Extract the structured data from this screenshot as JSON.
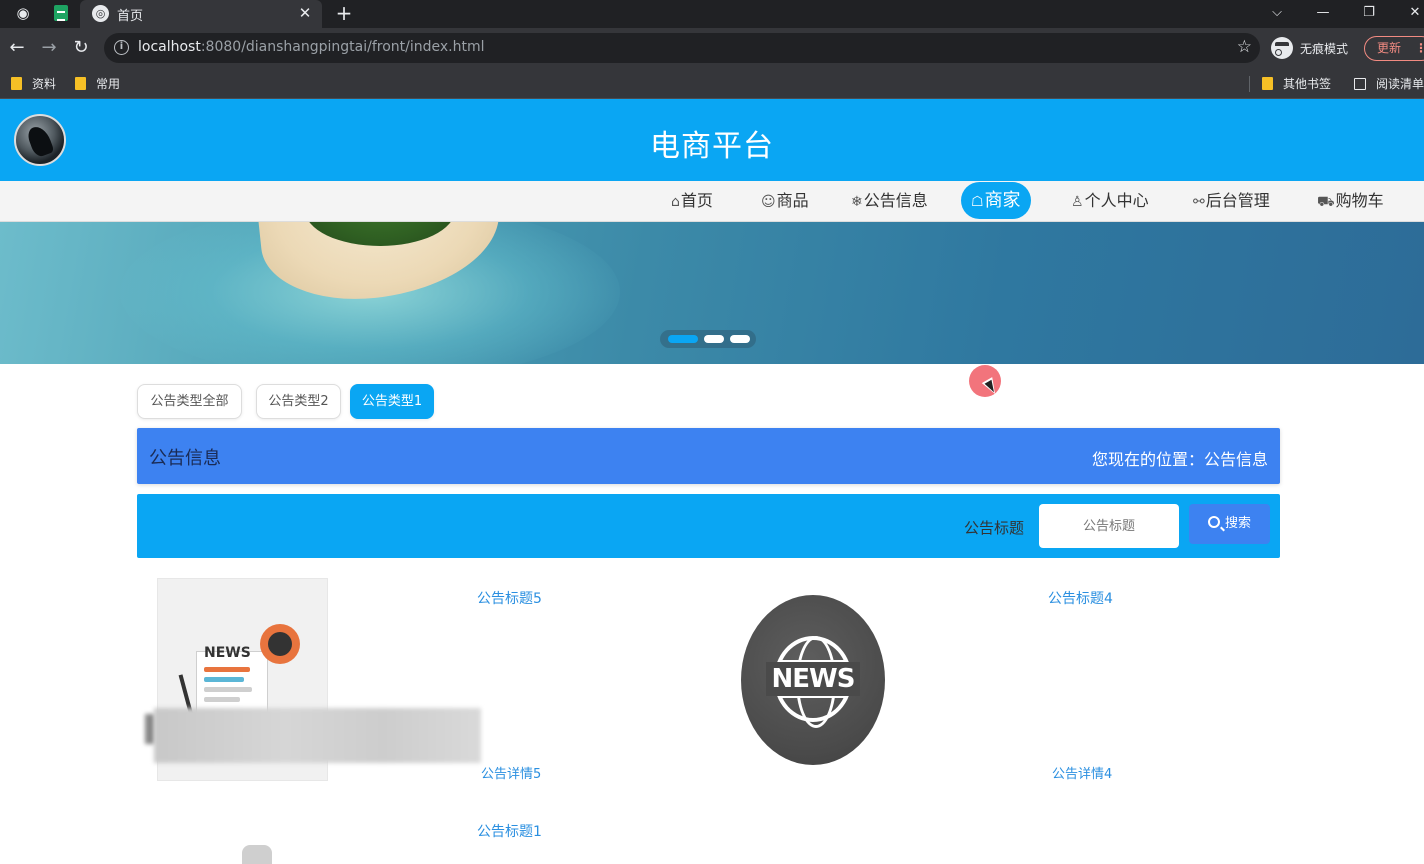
{
  "browser": {
    "tab_title": "首页",
    "url_host": "localhost",
    "url_rest": ":8080/dianshangpingtai/front/index.html",
    "incognito_label": "无痕模式",
    "update_label": "更新",
    "bookmarks": [
      {
        "label": "资料"
      },
      {
        "label": "常用"
      },
      {
        "label": "其他书签"
      },
      {
        "label": "阅读清单"
      }
    ]
  },
  "site": {
    "title": "电商平台",
    "nav": [
      {
        "icon": "⌂",
        "label": "首页"
      },
      {
        "icon": "☺",
        "label": "商品"
      },
      {
        "icon": "❄",
        "label": "公告信息"
      },
      {
        "icon": "☖",
        "label": "商家"
      },
      {
        "icon": "♙",
        "label": "个人中心"
      },
      {
        "icon": "⚯",
        "label": "后台管理"
      },
      {
        "icon": "⛟",
        "label": "购物车"
      }
    ],
    "active_nav": "商家"
  },
  "filters": [
    {
      "label": "公告类型全部"
    },
    {
      "label": "公告类型2"
    },
    {
      "label": "公告类型1"
    }
  ],
  "active_filter": "公告类型1",
  "section": {
    "title": "公告信息",
    "breadcrumb": "您现在的位置：公告信息"
  },
  "search": {
    "label": "公告标题",
    "placeholder": "公告标题",
    "button_label": "搜索"
  },
  "news_items": [
    {
      "title": "公告标题5",
      "detail": "公告详情5",
      "image_text": "NEWS"
    },
    {
      "title": "公告标题4",
      "detail": "公告详情4",
      "image_text": "NEWS"
    },
    {
      "title": "公告标题1"
    }
  ],
  "colors": {
    "header": "#0aa6f3",
    "section_bar": "#3d82f1",
    "link": "#2a8fe0"
  }
}
